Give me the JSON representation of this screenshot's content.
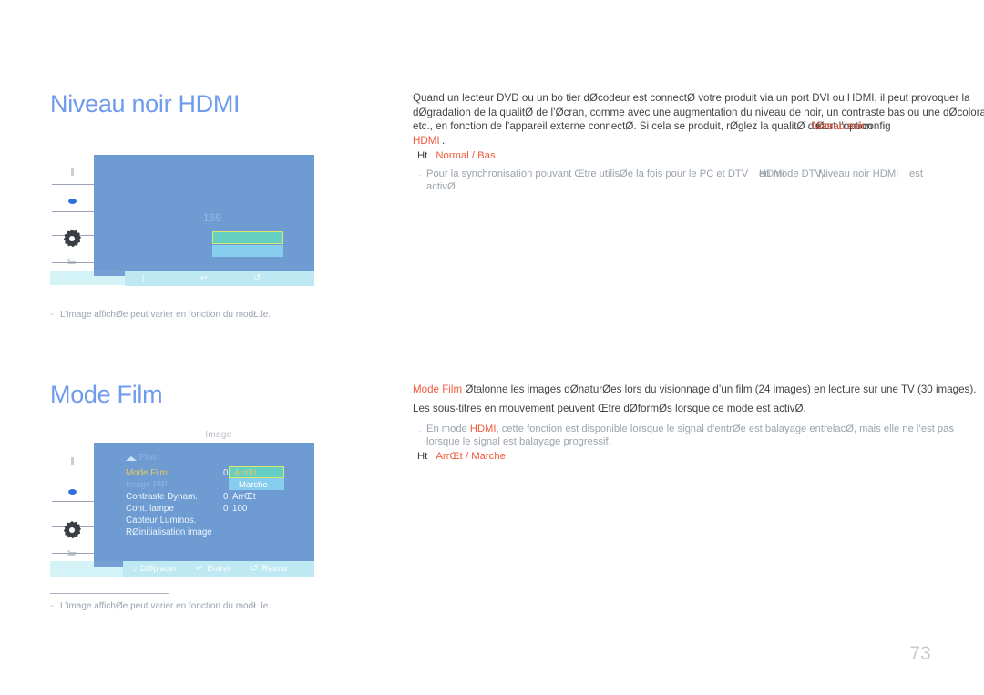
{
  "document": {
    "page_number": "73",
    "accent_heading_color": "#6f9bec",
    "accent_red_color": "#f05a3c"
  },
  "sections": [
    {
      "heading": "Niveau noir HDMI",
      "figure": {
        "title": "",
        "footbar": [
          {
            "glyph": "↕",
            "label": ""
          },
          {
            "glyph": "↵",
            "label": ""
          },
          {
            "glyph": "↺",
            "label": ""
          }
        ],
        "value_label": "169"
      },
      "footnote": {
        "dash": "-",
        "text": "L’image affichØe peut varier en fonction du modŁ.le."
      },
      "body": {
        "paragraph_lines": [
          "Quand un lecteur DVD ou un bo tier dØcodeur est connectØ   votre produit via un port DVI ou HDMI, il peut provoquer la",
          "dØgradation de la qualitØ de l’Øcran, comme avec une augmentation du niveau de noir, un contraste bas ou une dØcoloratio",
          "etc., en fonction de l’appareil externe connectØ. Si cela se produit, rØglez la qualitØ d’Øcran en config"
        ],
        "overlap_line3_black": "urant l’option",
        "overlap_line3_red": "Niveau noir",
        "paragraph_line4_red": "HDMI",
        "paragraph_line4_tail": ".",
        "ht_marker": "Ht",
        "ht_value": "Normal / Bas",
        "bullet": {
          "dot": "·",
          "line1_a": "Pour la synchronisation pouvant Œtre utilisØe   la fois pour le PC et DTV ",
          "line1_overlap_red": "HDMI",
          "line1_overlap_gray": "en mode DTV,",
          "line1_b": " Niveau noir HDMI",
          "line1_c": " est",
          "line2": "activØ."
        }
      }
    },
    {
      "heading": "Mode Film",
      "figure": {
        "title": "Image",
        "plus_label": "Plus",
        "rows": [
          {
            "label": "Mode Film",
            "state": "selected",
            "value_num": "0",
            "value_text": ""
          },
          {
            "label": "Image PIP",
            "state": "disabled",
            "value_num": "",
            "value_text": ""
          },
          {
            "label": "Contraste Dynam.",
            "state": "normal",
            "value_num": "0",
            "value_text": "ArrŒt"
          },
          {
            "label": "Cont. lampe",
            "state": "normal",
            "value_num": "0",
            "value_text": "100"
          },
          {
            "label": "Capteur Luminos.",
            "state": "normal",
            "value_num": "",
            "value_text": ""
          },
          {
            "label": "RØinitialisation image",
            "state": "normal",
            "value_num": "",
            "value_text": ""
          }
        ],
        "options": [
          {
            "label": "ArrŒt",
            "highlighted": true
          },
          {
            "label": "Marche",
            "highlighted": false
          }
        ],
        "footbar": [
          {
            "glyph": "↕",
            "label": "DØplacer"
          },
          {
            "glyph": "↵",
            "label": "Entrer"
          },
          {
            "glyph": "↺",
            "label": "Retour"
          }
        ]
      },
      "footnote": {
        "dash": "-",
        "text": "L’image affichØe peut varier en fonction du modŁ.le."
      },
      "body": {
        "line1_red": "Mode Film",
        "line1_rest": " Øtalonne les images dØnaturØes lors du visionnage d’un film (24 images) en lecture sur une TV (30 images).",
        "line2": "Les sous-titres en mouvement peuvent Œtre dØformØs lorsque ce mode est activØ.",
        "bullet": {
          "dot": "·",
          "line1_a": "En mode ",
          "line1_red": "HDMI",
          "line1_b": ", cette fonction est disponible lorsque le signal d’entrØe est   balayage entrelacØ, mais elle ne l’est pas",
          "line2": "lorsque le signal est   balayage progressif."
        },
        "ht_marker": "Ht",
        "ht_value": "ArrŒt / Marche"
      }
    }
  ]
}
